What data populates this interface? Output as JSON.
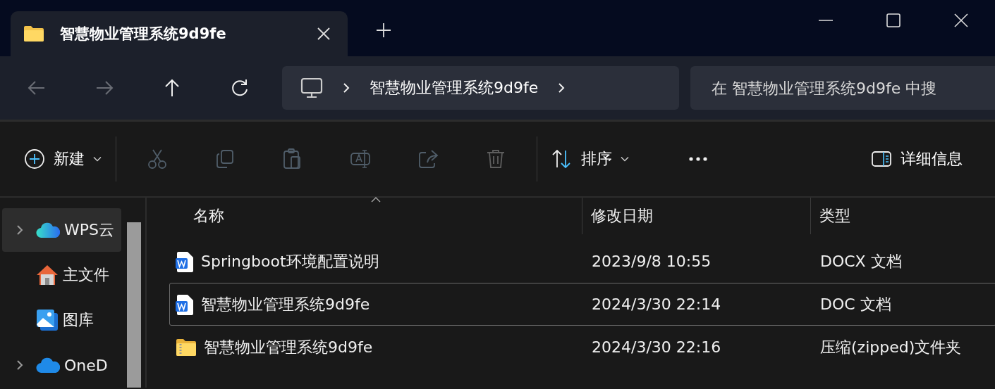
{
  "window": {
    "tab": {
      "title": "智慧物业管理系统9d9fe",
      "selected": true
    }
  },
  "nav": {
    "buttons": [
      {
        "disabled": true
      },
      {
        "disabled": true
      },
      {
        "disabled": false
      },
      {
        "disabled": false
      }
    ]
  },
  "address": {
    "crumbs": [
      "智慧物业管理系统9d9fe"
    ]
  },
  "search": {
    "placeholder": "在 智慧物业管理系统9d9fe 中搜"
  },
  "toolbar": {
    "items": [
      {
        "label": "新建",
        "dropdown": true,
        "disabled": false
      },
      {
        "disabled": true
      },
      {
        "disabled": true
      },
      {
        "disabled": true
      },
      {
        "disabled": true
      },
      {
        "disabled": true
      },
      {
        "disabled": true
      },
      {
        "label": "排序",
        "dropdown": true,
        "disabled": false
      },
      {
        "disabled": false
      },
      {
        "label": "详细信息",
        "dropdown": false,
        "disabled": false
      }
    ]
  },
  "sidebar": {
    "items": [
      {
        "label": "WPS云",
        "expandable": true,
        "selected": true
      },
      {
        "label": "主文件",
        "expandable": false,
        "selected": false
      },
      {
        "label": "图库",
        "expandable": false,
        "selected": false
      },
      {
        "label": "OneD",
        "expandable": true,
        "selected": false
      }
    ]
  },
  "files": {
    "columns": [
      {
        "label": "名称",
        "sorted": true
      },
      {
        "label": "修改日期",
        "sorted": false
      },
      {
        "label": "类型",
        "sorted": false
      }
    ],
    "rows": [
      {
        "kind": "document",
        "name": "Springboot环境配置说明",
        "modified": "2023/9/8 10:55",
        "type": "DOCX 文档",
        "selected": false
      },
      {
        "kind": "document",
        "name": "智慧物业管理系统9d9fe",
        "modified": "2024/3/30 22:14",
        "type": "DOC 文档",
        "selected": true
      },
      {
        "kind": "zip",
        "name": "智慧物业管理系统9d9fe",
        "modified": "2024/3/30 22:16",
        "type": "压缩(zipped)文件夹",
        "selected": false
      }
    ]
  }
}
